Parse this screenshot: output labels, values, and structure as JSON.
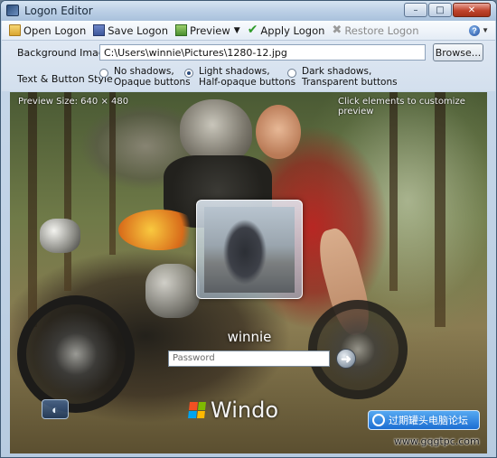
{
  "window": {
    "title": "Logon Editor",
    "caption_buttons": {
      "minimize": "–",
      "maximize": "□",
      "close": "✕"
    }
  },
  "toolbar": {
    "open_label": "Open Logon",
    "save_label": "Save Logon",
    "preview_label": "Preview",
    "apply_label": "Apply Logon",
    "restore_label": "Restore Logon",
    "help_glyph": "?"
  },
  "options": {
    "background_label": "Background Image",
    "background_path": "C:\\Users\\winnie\\Pictures\\1280-12.jpg",
    "browse_label": "Browse...",
    "style_label": "Text & Button Style",
    "style_options": [
      {
        "line1": "No shadows,",
        "line2": "Opaque buttons",
        "selected": false
      },
      {
        "line1": "Light shadows,",
        "line2": "Half-opaque buttons",
        "selected": true
      },
      {
        "line1": "Dark shadows,",
        "line2": "Transparent buttons",
        "selected": false
      }
    ]
  },
  "preview": {
    "size_text": "Preview Size: 640 × 480",
    "hint_text": "Click elements to customize preview",
    "user_name": "winnie",
    "password_placeholder": "Password",
    "go_glyph": "➜",
    "ease_glyph": "◐",
    "brand_text": "Windo",
    "watermark_text": "过期罐头电脑论坛",
    "watermark_url": "www.gqgtpc.com",
    "flag_colors": [
      "#f25022",
      "#7fba00",
      "#00a4ef",
      "#ffb900"
    ]
  }
}
